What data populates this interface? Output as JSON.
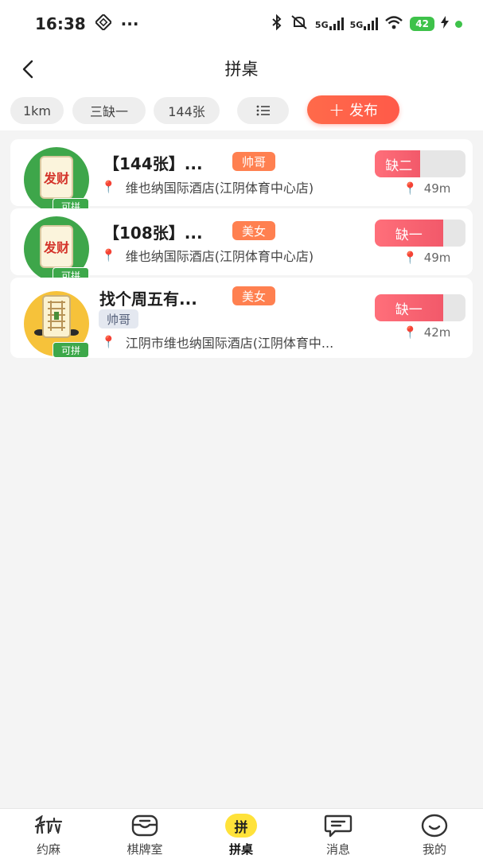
{
  "status_bar": {
    "time": "16:38",
    "more": "···",
    "signal_1": "5G",
    "signal_2": "5G",
    "battery": "42",
    "icons": [
      "nfc-icon",
      "bluetooth-icon",
      "mute-icon",
      "wifi-icon",
      "charging-icon"
    ]
  },
  "nav": {
    "title": "拼桌"
  },
  "filters": {
    "distance": "1km",
    "seats": "三缺一",
    "tiles": "144张",
    "list_icon": "list-icon",
    "publish_label": "发布"
  },
  "cards": [
    {
      "title": "【144张】...",
      "tag": "帅哥",
      "address": "维也纳国际酒店(江阴体育中心店)",
      "status": "缺二",
      "fill": 0.5,
      "distance": "49m",
      "avatar_tag": "可拼",
      "avatar_tile": "发财"
    },
    {
      "title": "【108张】...",
      "tag": "美女",
      "address": "维也纳国际酒店(江阴体育中心店)",
      "status": "缺一",
      "fill": 0.75,
      "distance": "49m",
      "avatar_tag": "可拼",
      "avatar_tile": "发财"
    },
    {
      "title": "找个周五有...",
      "tag": "美女",
      "user_tag": "帅哥",
      "address": "江阴市维也纳国际酒店(江阴体育中...",
      "status": "缺一",
      "fill": 0.75,
      "distance": "42m",
      "avatar_tag": "可拼"
    }
  ],
  "tabs": [
    {
      "label": "约麻",
      "icon": "yuema-logo-icon"
    },
    {
      "label": "棋牌室",
      "icon": "mahjong-room-icon"
    },
    {
      "label": "拼桌",
      "icon": "pin-badge-icon",
      "badge": "拼",
      "active": true
    },
    {
      "label": "消息",
      "icon": "message-icon"
    },
    {
      "label": "我的",
      "icon": "smile-icon"
    }
  ],
  "colors": {
    "accent": "#ff5a49",
    "tag_orange": "#ff8050",
    "slot_fill": "#f2596a",
    "avatar_green": "#3da84a",
    "tab_active_badge": "#ffe23a"
  }
}
